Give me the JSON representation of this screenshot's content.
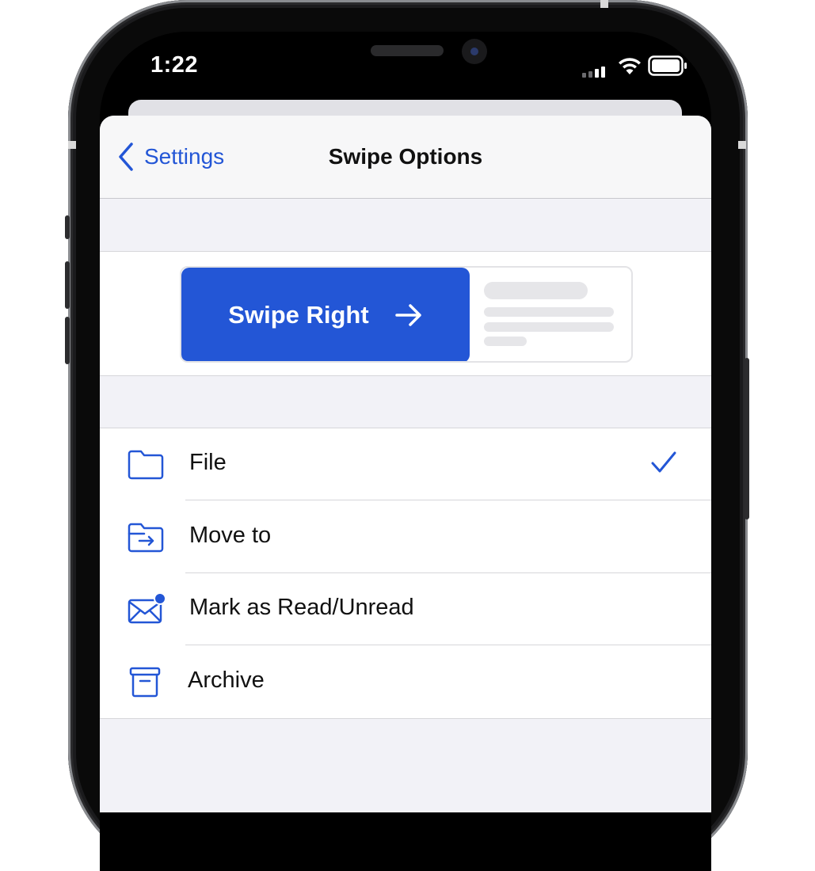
{
  "status_bar": {
    "time": "1:22"
  },
  "nav": {
    "back_label": "Settings",
    "title": "Swipe Options"
  },
  "preview": {
    "action_label": "Swipe Right",
    "action_icon": "arrow-right-icon"
  },
  "options": [
    {
      "label": "File",
      "icon": "folder-icon",
      "selected": true
    },
    {
      "label": "Move to",
      "icon": "folder-move-icon",
      "selected": false
    },
    {
      "label": "Mark as Read/Unread",
      "icon": "mail-unread-icon",
      "selected": false
    },
    {
      "label": "Archive",
      "icon": "archive-box-icon",
      "selected": false
    }
  ],
  "colors": {
    "accent": "#2356d6",
    "background": "#f2f2f7"
  }
}
